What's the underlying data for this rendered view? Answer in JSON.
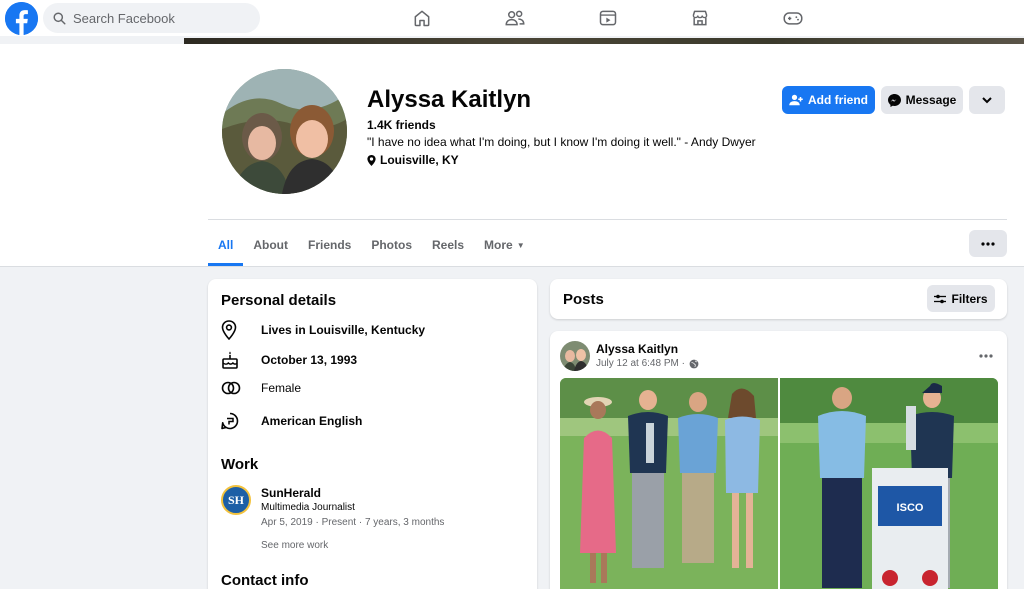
{
  "search": {
    "placeholder": "Search Facebook"
  },
  "nav": {
    "icons": [
      "home-icon",
      "friends-icon",
      "video-icon",
      "marketplace-icon",
      "gaming-icon"
    ]
  },
  "profile": {
    "name": "Alyssa Kaitlyn",
    "friends": "1.4K friends",
    "bio": "\"I have no idea what I'm doing, but I know I'm doing it well.\" - Andy Dwyer",
    "location": "Louisville, KY"
  },
  "actions": {
    "add_friend": "Add friend",
    "message": "Message"
  },
  "tabs": [
    {
      "label": "All"
    },
    {
      "label": "About"
    },
    {
      "label": "Friends"
    },
    {
      "label": "Photos"
    },
    {
      "label": "Reels"
    },
    {
      "label": "More"
    }
  ],
  "personal_details": {
    "title": "Personal details",
    "items": [
      {
        "icon": "location-pin-icon",
        "text": "Lives in Louisville, Kentucky"
      },
      {
        "icon": "birthday-cake-icon",
        "text": "October 13, 1993"
      },
      {
        "icon": "gender-icon",
        "text": "Female"
      },
      {
        "icon": "language-icon",
        "text": "American English"
      }
    ]
  },
  "work": {
    "title": "Work",
    "logo_text": "SH",
    "company": "SunHerald",
    "role": "Multimedia Journalist",
    "dates": "Apr 5, 2019 · Present · 7 years, 3 months",
    "see_more": "See more work"
  },
  "contact": {
    "title": "Contact info"
  },
  "posts": {
    "title": "Posts",
    "filters": "Filters",
    "post": {
      "author": "Alyssa Kaitlyn",
      "time": "July 12 at 6:48 PM ·"
    }
  },
  "colors": {
    "brand": "#1877f2",
    "background": "#f0f2f5",
    "secondary_text": "#65676b"
  }
}
